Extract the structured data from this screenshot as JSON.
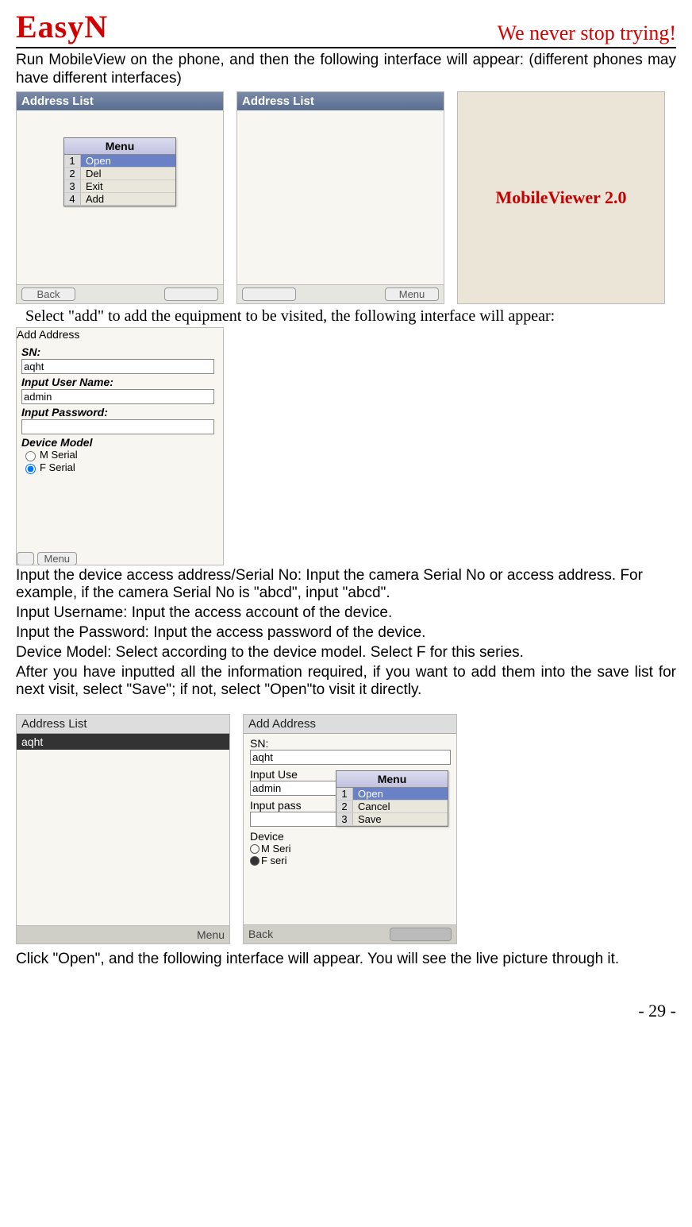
{
  "header": {
    "logo": "EasyN",
    "tagline": "We never stop trying!"
  },
  "intro": "Run MobileView on the phone, and then the following interface will appear: (different phones may have different interfaces)",
  "screenshots_row1": {
    "ss1": {
      "title": "Address List",
      "menu_title": "Menu",
      "menu_items": [
        "Open",
        "Del",
        "Exit",
        "Add"
      ],
      "back": "Back"
    },
    "ss2": {
      "title": "Address List",
      "menu_softkey": "Menu"
    },
    "ss3": {
      "splash": "MobileViewer 2.0"
    }
  },
  "select_add_text": "Select \"add\" to add the equipment to be visited, the following interface will appear:",
  "add_screen": {
    "title": "Add Address",
    "sn_label": "SN:",
    "sn_value": "aqht",
    "user_label": "Input User Name:",
    "user_value": "admin",
    "pass_label": "Input Password:",
    "pass_value": "",
    "model_label": "Device Model",
    "radio_m": "M Serial",
    "radio_f": "F Serial",
    "menu_softkey": "Menu"
  },
  "instructions": [
    "Input the device access address/Serial No: Input the camera Serial No or access address. For example, if the camera Serial No is \"abcd\", input \"abcd\".",
    "Input Username: Input the access account of the device.",
    "Input the Password: Input the access password of the device.",
    "Device Model: Select according to the device model. Select F for this series.",
    "After you have inputted all the information required, if you want to add them into the save list for next visit, select \"Save\"; if not, select \"Open\"to visit it directly."
  ],
  "screenshots_row2": {
    "ss_a": {
      "title": "Address List",
      "item": "aqht",
      "menu_softkey": "Menu"
    },
    "ss_b": {
      "title": "Add Address",
      "sn_label": "SN:",
      "sn_value": "aqht",
      "user_label": "Input Use",
      "user_value": "admin",
      "pass_label": "Input pass",
      "model_label": "Device",
      "radio_m": "M Seri",
      "radio_f": "F seri",
      "menu_title": "Menu",
      "menu_items": [
        "Open",
        "Cancel",
        "Save"
      ],
      "back": "Back"
    }
  },
  "click_open_text": "Click \"Open\", and the following interface will appear. You will see the live picture through it.",
  "page_number": "- 29 -"
}
